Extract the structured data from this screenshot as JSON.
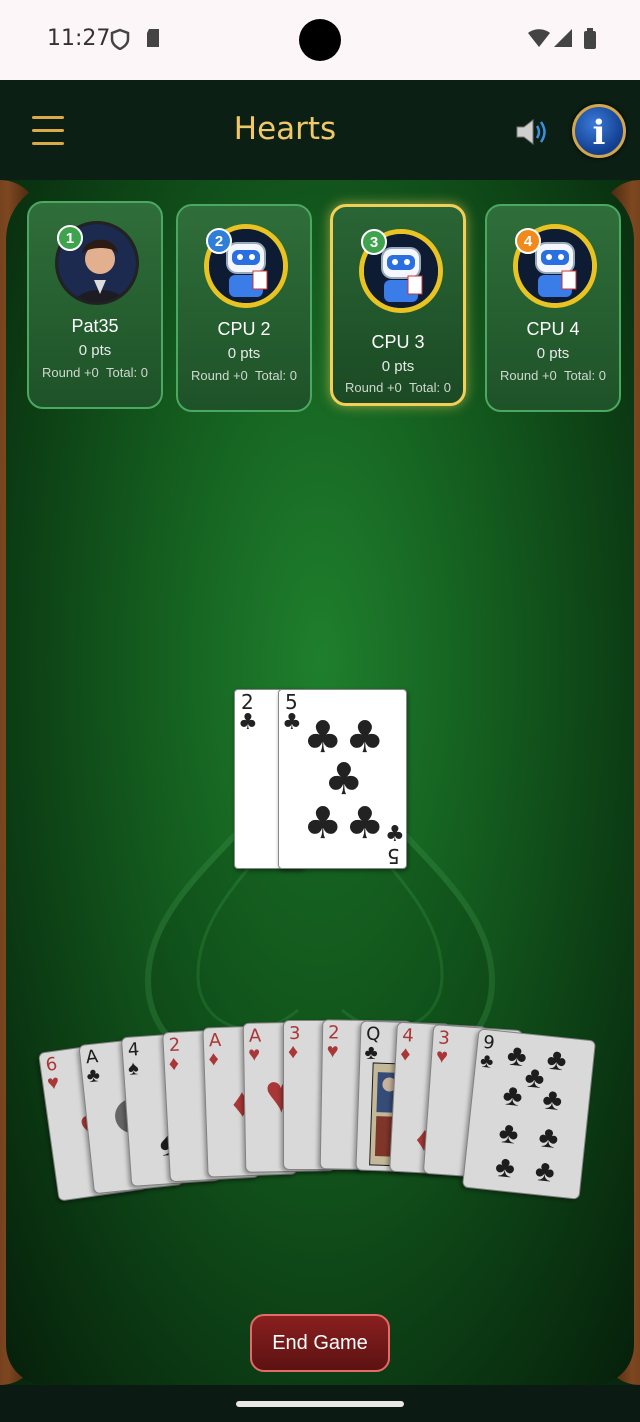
{
  "status_bar": {
    "time": "11:27"
  },
  "header": {
    "title": "Hearts",
    "menu_icon": "hamburger-icon",
    "sound_icon": "speaker-icon",
    "info_label": "i"
  },
  "players": [
    {
      "seat": "1",
      "name": "Pat35",
      "pts": "0 pts",
      "round": "Round +0",
      "total": "Total: 0",
      "badge_color": "#3fa34d",
      "active": false
    },
    {
      "seat": "2",
      "name": "CPU 2",
      "pts": "0 pts",
      "round": "Round +0",
      "total": "Total: 0",
      "badge_color": "#2f7fd8",
      "active": false
    },
    {
      "seat": "3",
      "name": "CPU 3",
      "pts": "0 pts",
      "round": "Round +0",
      "total": "Total: 0",
      "badge_color": "#3fa34d",
      "active": true
    },
    {
      "seat": "4",
      "name": "CPU 4",
      "pts": "0 pts",
      "round": "Round +0",
      "total": "Total: 0",
      "badge_color": "#f08a1c",
      "active": false
    }
  ],
  "trick": [
    {
      "rank": "2",
      "suit": "♣"
    },
    {
      "rank": "5",
      "suit": "♣"
    }
  ],
  "hand": [
    {
      "rank": "6",
      "suit": "♥"
    },
    {
      "rank": "A",
      "suit": "♣"
    },
    {
      "rank": "4",
      "suit": "♠"
    },
    {
      "rank": "2",
      "suit": "♦"
    },
    {
      "rank": "A",
      "suit": "♦"
    },
    {
      "rank": "A",
      "suit": "♥"
    },
    {
      "rank": "3",
      "suit": "♦"
    },
    {
      "rank": "2",
      "suit": "♥"
    },
    {
      "rank": "Q",
      "suit": "♣"
    },
    {
      "rank": "4",
      "suit": "♦"
    },
    {
      "rank": "3",
      "suit": "♥"
    },
    {
      "rank": "9",
      "suit": "♣"
    }
  ],
  "end_game_label": "End Game"
}
